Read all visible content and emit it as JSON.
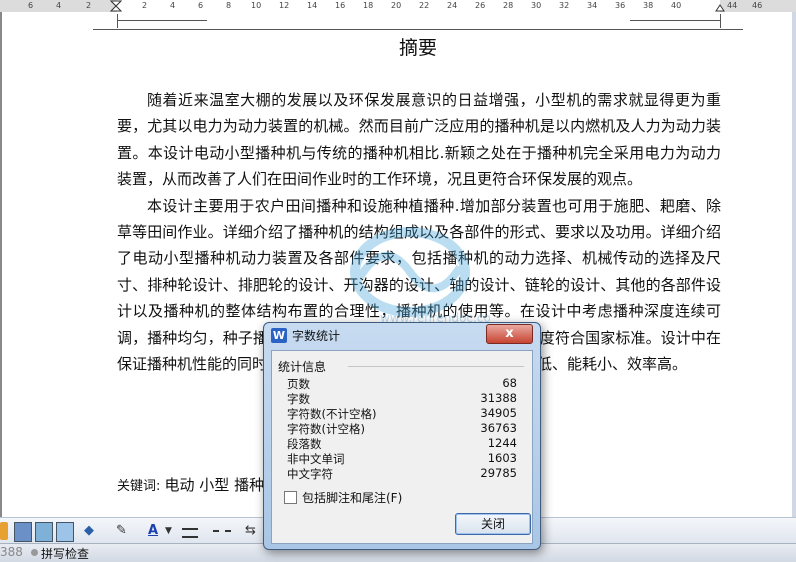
{
  "ruler": {
    "numbers": [
      "6",
      "4",
      "2",
      "",
      "2",
      "4",
      "6",
      "8",
      "10",
      "12",
      "14",
      "16",
      "18",
      "20",
      "22",
      "24",
      "26",
      "28",
      "30",
      "32",
      "34",
      "36",
      "38",
      "40",
      "",
      "44",
      "46"
    ]
  },
  "document": {
    "title": "摘要",
    "paragraphs": [
      "随着近来温室大棚的发展以及环保发展意识的日益增强，小型机的需求就显得更为重要，尤其以电力为动力装置的机械。然而目前广泛应用的播种机是以内燃机及人力为动力装置。本设计电动小型播种机与传统的播种机相比.新颖之处在于播种机完全采用电力为动力装置，从而改善了人们在田间作业时的工作环境，况且更符合环保发展的观点。",
      "本设计主要用于农户田间播种和设施种植播种.增加部分装置也可用于施肥、耙磨、除草等田间作业。详细介绍了播种机的结构组成以及各部件的形式、要求以及功用。详细介绍了电动小型播种机动力装置及各部件要求，包括播种机的动力选择、机械传动的选择及尺寸、排种轮设计、排肥轮的设计、开沟器的设计、轴的设计、链轮的设计、其他的各部件设计以及播种机的整体结构布置的合理性，播种机的使用等。在设计中考虑播种深度连续可调，播种均匀，种子播种在合适的深度，种子破碎率和播种均匀度符合国家标准。设计中在保证播种机性能的同时，尽量使播种机达到结构合理、生产成本低、能耗小、效率高。"
    ],
    "keywords_label": "关键词:",
    "keywords": "电动 小型 播种机"
  },
  "toolbar": {
    "font_color_glyph": "A",
    "partial_count": "388",
    "spellcheck": "拼写检查"
  },
  "dialog": {
    "title": "字数统计",
    "icon_letter": "W",
    "close_glyph": "x",
    "group_label": "统计信息",
    "rows": [
      {
        "label": "页数",
        "value": "68"
      },
      {
        "label": "字数",
        "value": "31388"
      },
      {
        "label": "字符数(不计空格)",
        "value": "34905"
      },
      {
        "label": "字符数(计空格)",
        "value": "36763"
      },
      {
        "label": "段落数",
        "value": "1244"
      },
      {
        "label": "非中文单词",
        "value": "1603"
      },
      {
        "label": "中文字符",
        "value": "29785"
      }
    ],
    "checkbox_label": "包括脚注和尾注(F)",
    "checkbox_checked": false,
    "close_button": "关闭"
  },
  "colors": {
    "dialog_frame": "#a9c6e6",
    "close_red": "#c74432",
    "watermark": "#3fa0d8"
  }
}
